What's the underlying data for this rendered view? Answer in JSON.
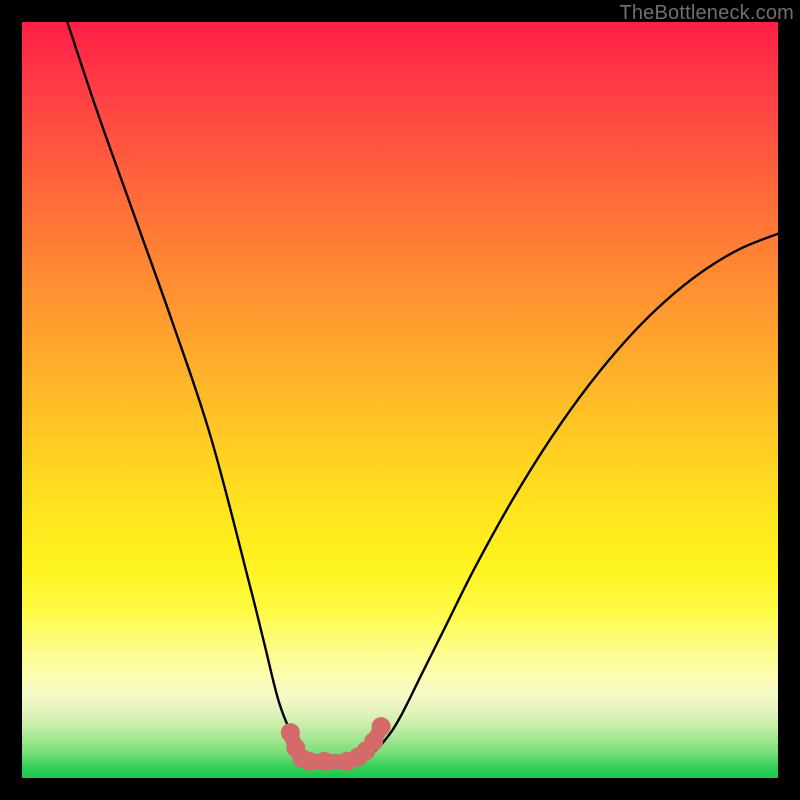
{
  "watermark": "TheBottleneck.com",
  "chart_data": {
    "type": "line",
    "title": "",
    "xlabel": "",
    "ylabel": "",
    "xlim": [
      0,
      100
    ],
    "ylim": [
      0,
      100
    ],
    "series": [
      {
        "name": "bottleneck-curve",
        "x": [
          6,
          10,
          15,
          20,
          25,
          30,
          32,
          34,
          36,
          37,
          38,
          39,
          40,
          42,
          44,
          46,
          48,
          50,
          53,
          56,
          60,
          65,
          70,
          75,
          80,
          85,
          90,
          95,
          100
        ],
        "values": [
          100,
          88,
          74,
          60,
          45,
          26,
          18,
          10,
          5,
          3,
          2,
          2,
          2,
          2,
          2,
          3,
          5,
          8,
          14,
          20,
          28,
          37,
          45,
          52,
          58,
          63,
          67,
          70,
          72
        ]
      }
    ],
    "markers": {
      "name": "bottom-markers",
      "color": "#d46a6a",
      "x": [
        35.5,
        36.2,
        37.0,
        38.0,
        40.0,
        43.0,
        44.5,
        45.5,
        46.5,
        47.5
      ],
      "values": [
        6.0,
        4.0,
        2.6,
        2.2,
        2.2,
        2.2,
        2.8,
        3.6,
        4.8,
        6.8
      ]
    },
    "gradient_bands": [
      {
        "stop": 0,
        "color": "#ff1f47"
      },
      {
        "stop": 50,
        "color": "#ffb629"
      },
      {
        "stop": 78,
        "color": "#fffb45"
      },
      {
        "stop": 100,
        "color": "#17c94c"
      }
    ]
  }
}
